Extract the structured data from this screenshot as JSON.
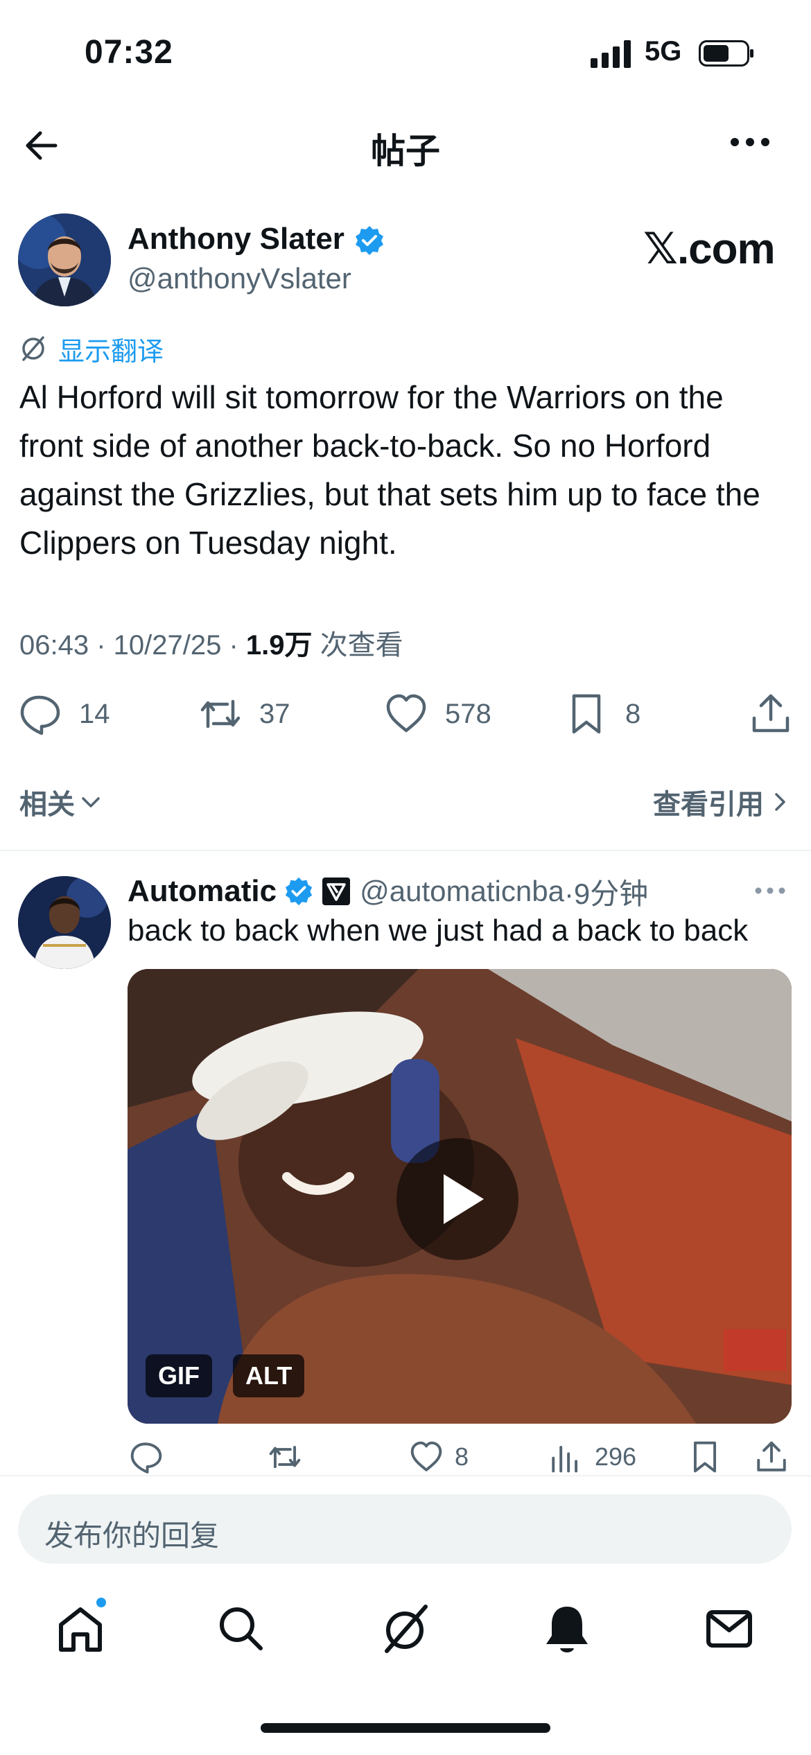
{
  "status_bar": {
    "time": "07:32",
    "network": "5G"
  },
  "header": {
    "title": "帖子"
  },
  "tweet": {
    "author_name": "Anthony Slater",
    "author_handle": "@anthonyVslater",
    "source_logo": "𝕏.com",
    "translate_label": "显示翻译",
    "text": "Al Horford will sit tomorrow for the Warriors on the front side of another back-to-back. So no Horford against the Grizzlies, but that sets him up to face the Clippers on Tuesday night.",
    "timestamp": "06:43 · 10/27/25 · ",
    "views": "1.9万",
    "views_label": " 次查看",
    "replies": "14",
    "reposts": "37",
    "likes": "578",
    "bookmarks": "8"
  },
  "related": {
    "left_label": "相关",
    "right_label": "查看引用"
  },
  "reply": {
    "author_name": "Automatic",
    "author_handle": "@automaticnba",
    "time": "·9分钟",
    "text": "back to back when we just had a back to back",
    "media_badges": [
      "GIF",
      "ALT"
    ],
    "likes": "8",
    "views": "296"
  },
  "composer": {
    "placeholder": "发布你的回复"
  },
  "colors": {
    "accent": "#1d9bf0",
    "text": "#0f1419",
    "muted": "#536471"
  },
  "icons": [
    "back-arrow-icon",
    "more-icon",
    "verified-icon",
    "translate-icon",
    "reply-icon",
    "repost-icon",
    "like-icon",
    "bookmark-icon",
    "share-icon",
    "views-icon",
    "home-icon",
    "search-icon",
    "grok-icon",
    "bell-icon",
    "mail-icon"
  ]
}
